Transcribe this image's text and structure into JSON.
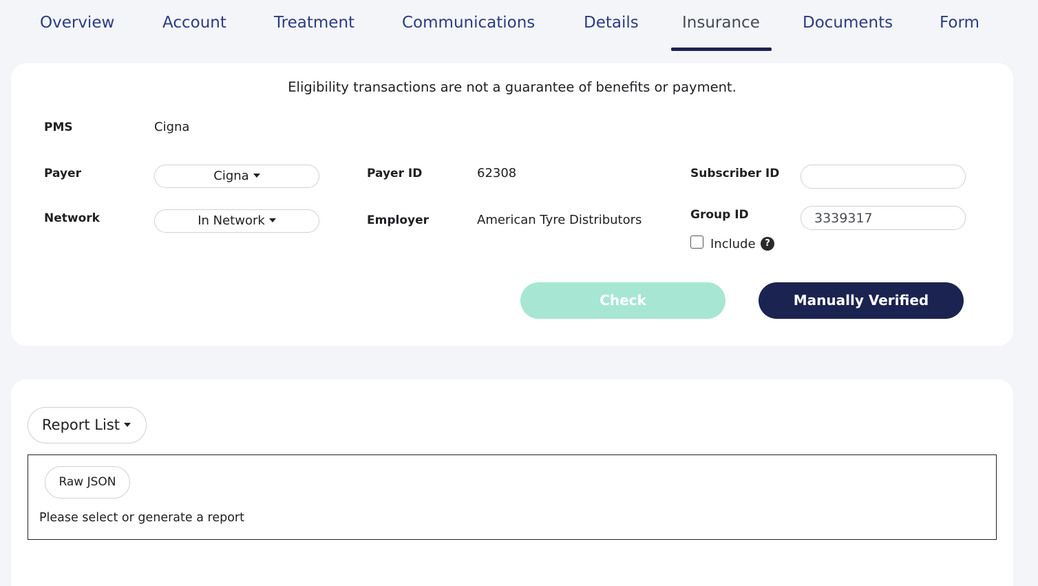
{
  "tabs": [
    {
      "label": "Overview"
    },
    {
      "label": "Account"
    },
    {
      "label": "Treatment"
    },
    {
      "label": "Communications"
    },
    {
      "label": "Details"
    },
    {
      "label": "Insurance",
      "active": true
    },
    {
      "label": "Documents"
    },
    {
      "label": "Form"
    }
  ],
  "eligibility": {
    "notice": "Eligibility transactions are not a guarantee of benefits or payment.",
    "pms_label": "PMS",
    "pms_value": "Cigna",
    "payer_label": "Payer",
    "payer_value": "Cigna",
    "network_label": "Network",
    "network_value": "In Network",
    "payer_id_label": "Payer ID",
    "payer_id_value": "62308",
    "employer_label": "Employer",
    "employer_value": "American Tyre Distributors",
    "subscriber_id_label": "Subscriber ID",
    "subscriber_id_value": "",
    "group_id_label": "Group ID",
    "group_id_value": "3339317",
    "include_label": "Include",
    "include_checked": false,
    "help_glyph": "?",
    "check_button": "Check",
    "manual_button": "Manually Verified"
  },
  "report": {
    "dropdown_label": "Report List",
    "raw_json_button": "Raw JSON",
    "empty_message": "Please select or generate a report"
  },
  "colors": {
    "accent_dark": "#1b2350",
    "tab_text": "#2b3d80",
    "check_disabled": "#a7e6d3",
    "page_bg": "#f4f5f9"
  }
}
